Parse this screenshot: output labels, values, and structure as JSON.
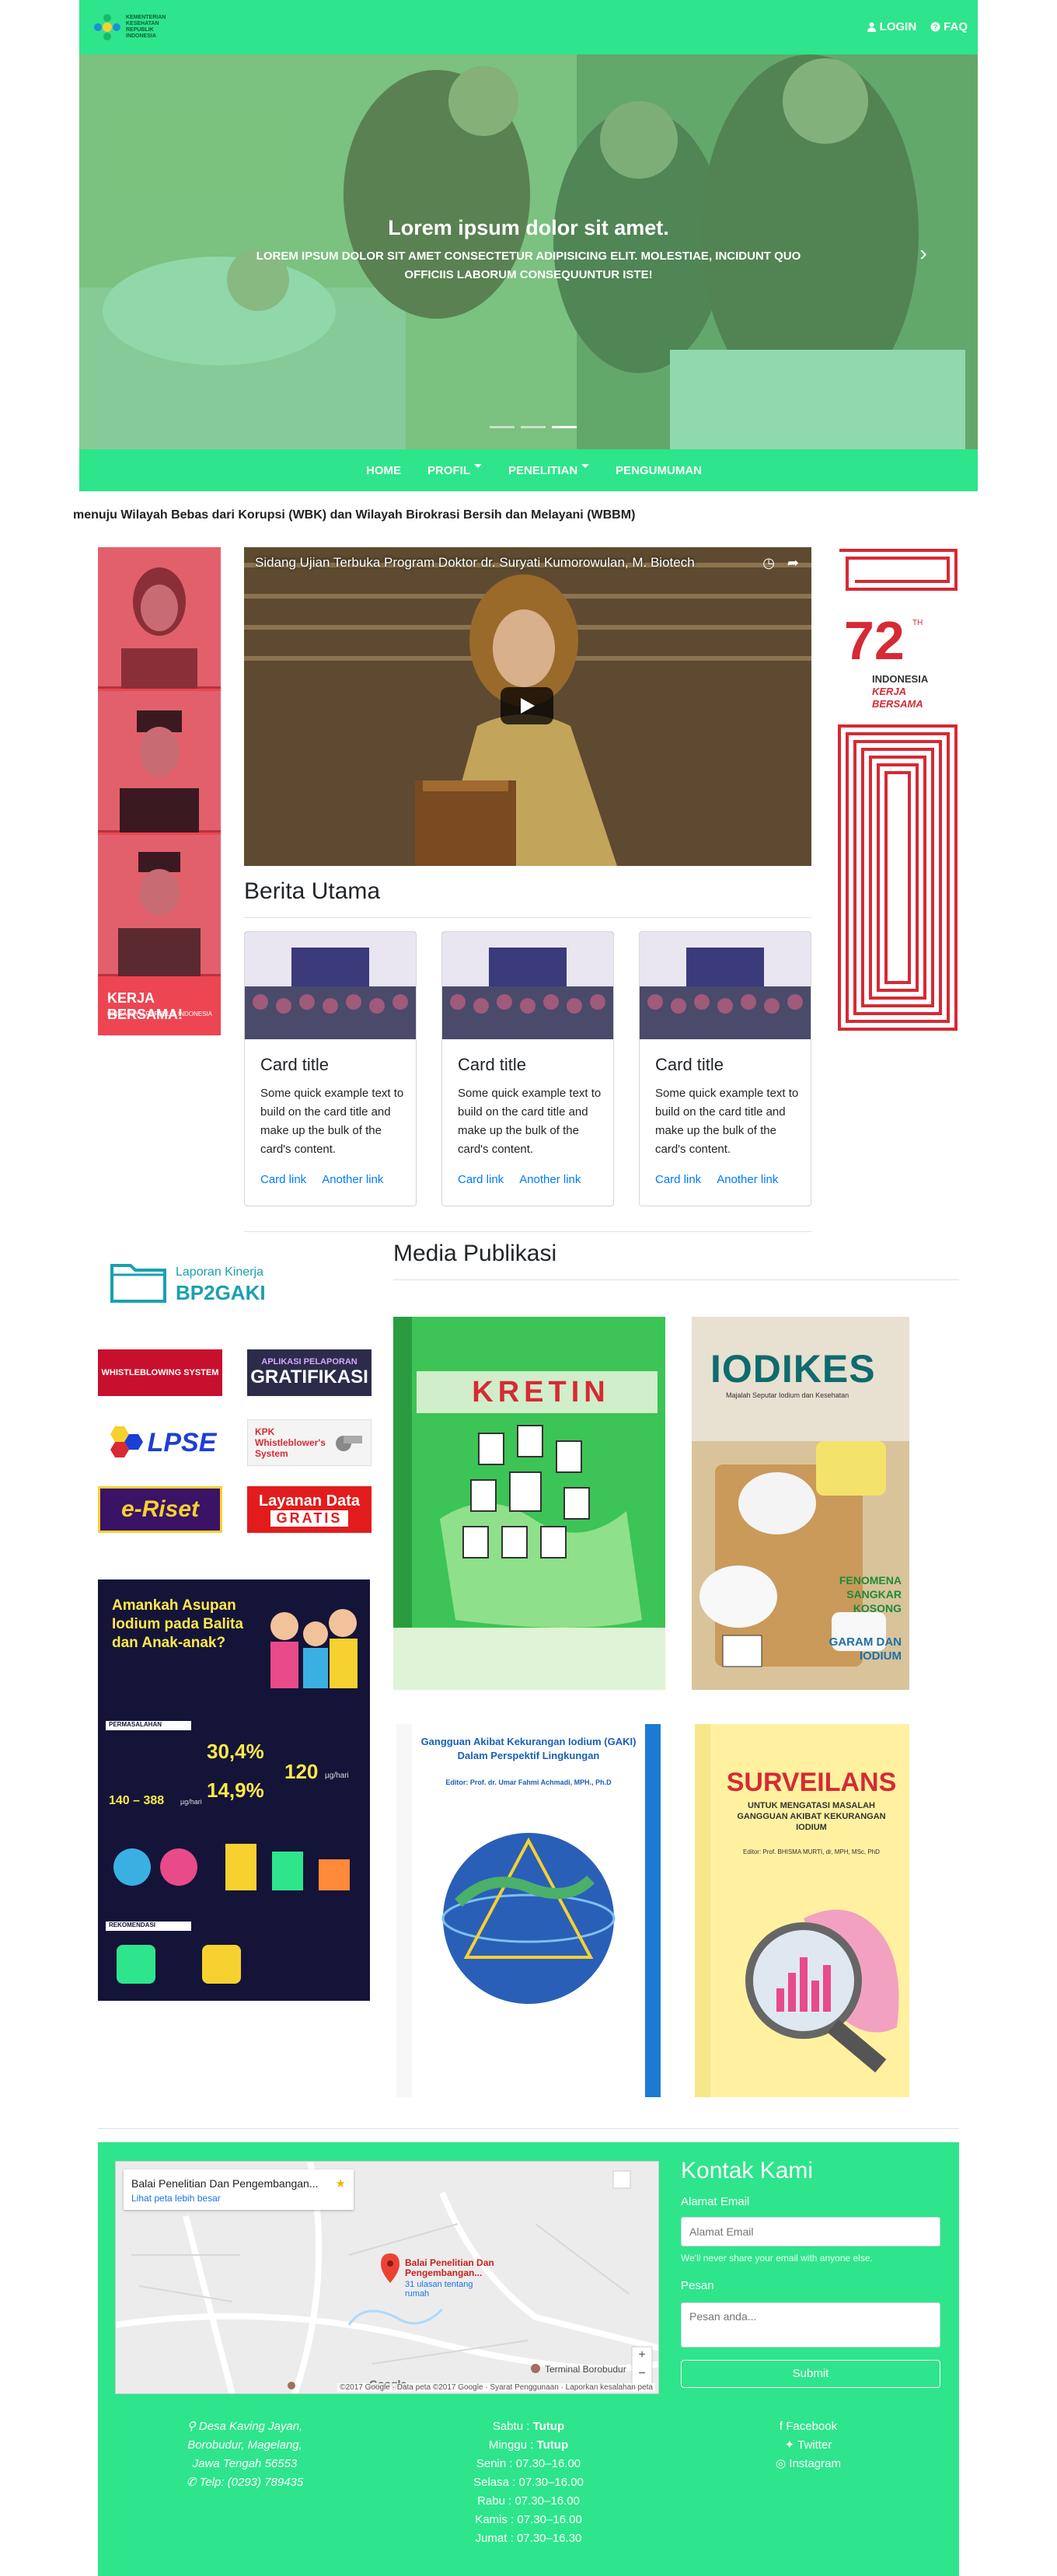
{
  "header": {
    "logo_text": "KEMENTERIAN\nKESEHATAN\nREPUBLIK\nINDONESIA",
    "login_label": "LOGIN",
    "faq_label": "FAQ",
    "brand_color": "#2ee58b"
  },
  "carousel": {
    "caption_title": "Lorem ipsum dolor sit amet.",
    "caption_text": "Lorem ipsum dolor sit amet consectetur adipisicing elit. Molestiae, incidunt quo officiis laborum consequuntur iste!",
    "slide_count": 3,
    "active_slide": 2
  },
  "nav": {
    "items": [
      {
        "label": "HOME"
      },
      {
        "label": "PROFIL"
      },
      {
        "label": "PENELITIAN"
      },
      {
        "label": "PENGUMUMAN"
      }
    ]
  },
  "ticker": "menuju Wilayah Bebas dari Korupsi (WBK) dan Wilayah Birokrasi Bersih dan Melayani (WBBM)",
  "left_banner": {
    "title": "KERJA BERSAMA!",
    "subtitle": "DIRGAHAYU REPUBLIK INDONESIA"
  },
  "right_banner": {
    "number": "72",
    "suffix": "TH",
    "line1": "INDONESIA",
    "line2": "KERJA",
    "line3": "BERSAMA"
  },
  "video": {
    "title": "Sidang Ujian Terbuka Program Doktor dr. Suryati Kumorowulan, M. Biotech"
  },
  "berita": {
    "heading": "Berita Utama",
    "cards": [
      {
        "title": "Card title",
        "text": "Some quick example text to build on the card title and make up the bulk of the card's content.",
        "link1": "Card link",
        "link2": "Another link"
      },
      {
        "title": "Card title",
        "text": "Some quick example text to build on the card title and make up the bulk of the card's content.",
        "link1": "Card link",
        "link2": "Another link"
      },
      {
        "title": "Card title",
        "text": "Some quick example text to build on the card title and make up the bulk of the card's content.",
        "link1": "Card link",
        "link2": "Another link"
      }
    ]
  },
  "laporan": {
    "line1": "Laporan Kinerja",
    "line2": "BP2GAKI"
  },
  "links": {
    "whistleblowing": "WHISTLEBLOWING SYSTEM",
    "gratifikasi_top": "APLIKASI PELAPORAN",
    "gratifikasi": "GRATIFIKASI",
    "lpse": "LPSE",
    "kpk": "KPK Whistleblower's System",
    "eriset": "e-Riset",
    "layanan_data_1": "Layanan Data",
    "layanan_data_2": "GRATIS"
  },
  "infographic": {
    "heading": "Amankah Asupan Iodium pada Balita dan Anak-anak?",
    "permasalahan": "PERMASALAHAN",
    "rekomendasi": "REKOMENDASI",
    "stat1": "30,4%",
    "stat2": "14,9%",
    "stat3": "120",
    "stat3_unit": "µg/hari",
    "range": "140 – 388",
    "range_unit": "µg/hari"
  },
  "media": {
    "heading": "Media Publikasi",
    "books": [
      {
        "title": "KRETIN"
      },
      {
        "title": "IODIKES",
        "subtitle": "Majalah Seputar Iodium dan Kesehatan",
        "feature1": "FENOMENA SANGKAR KOSONG",
        "feature2": "GARAM DAN IODIUM"
      },
      {
        "title": "Gangguan Akibat Kekurangan Iodium (GAKI) Dalam Perspektif Lingkungan",
        "editor": "Editor: Prof. dr. Umar Fahmi Achmadi, MPH., Ph.D"
      },
      {
        "title": "SURVEILANS",
        "subtitle": "UNTUK MENGATASI MASALAH GANGGUAN AKIBAT KEKURANGAN IODIUM",
        "editor": "Editor: Prof. BHISMA MURTI, dr, MPH, MSc, PhD"
      }
    ]
  },
  "footer": {
    "map": {
      "place_title": "Balai Penelitian Dan Pengembangan...",
      "larger_map_link": "Lihat peta lebih besar",
      "pin_label": "Balai Penelitian Dan Pengembangan...",
      "pin_sub": "31 ulasan tentang rumah",
      "landmark": "Terminal Borobudur",
      "attribution": "©2017 Google · Data peta ©2017 Google · Syarat Penggunaan · Laporkan kesalahan peta"
    },
    "kontak": {
      "heading": "Kontak Kami",
      "email_label": "Alamat Email",
      "email_placeholder": "Alamat Email",
      "email_help": "We'll never share your email with anyone else.",
      "message_label": "Pesan",
      "message_placeholder": "Pesan anda...",
      "submit_label": "Submit"
    },
    "address": [
      "Desa Kaving Jayan,",
      "Borobudur, Magelang,",
      "Jawa Tengah 56553",
      "Telp: (0293) 789435"
    ],
    "hours": [
      {
        "day": "Sabtu",
        "time": "Tutup",
        "bold": true
      },
      {
        "day": "Minggu",
        "time": "Tutup",
        "bold": true
      },
      {
        "day": "Senin",
        "time": "07.30–16.00",
        "bold": false
      },
      {
        "day": "Selasa",
        "time": "07.30–16.00",
        "bold": false
      },
      {
        "day": "Rabu",
        "time": "07.30–16.00",
        "bold": false
      },
      {
        "day": "Kamis",
        "time": "07.30–16.00",
        "bold": false
      },
      {
        "day": "Jumat",
        "time": "07.30–16.30",
        "bold": false
      }
    ],
    "social": [
      "Facebook",
      "Twitter",
      "Instagram"
    ]
  }
}
